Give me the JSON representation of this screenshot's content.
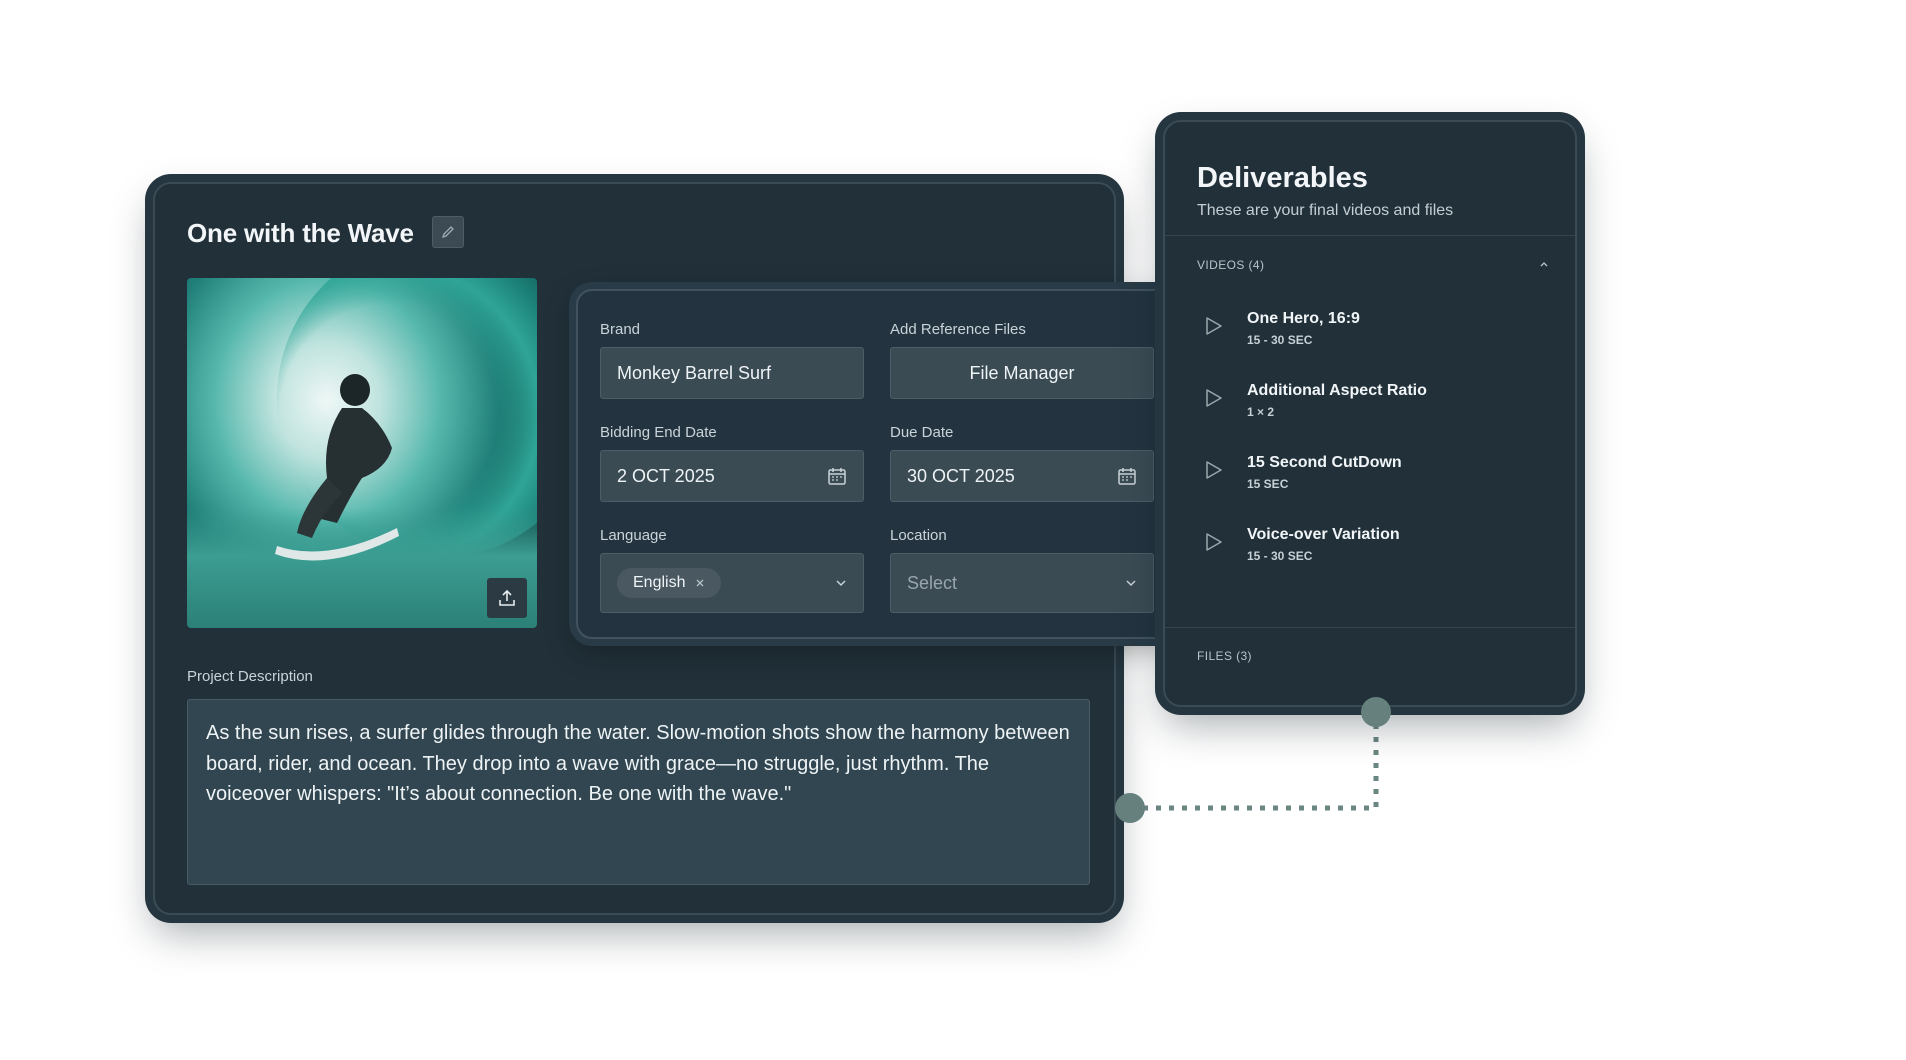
{
  "project": {
    "title": "One with the Wave",
    "description_label": "Project Description",
    "description": "As the sun rises, a surfer glides through the water. Slow-motion shots show the harmony between board, rider, and ocean. They drop into a wave with grace—no struggle, just rhythm. The voiceover whispers: \"It’s about connection. Be one with the wave.\""
  },
  "form": {
    "brand_label": "Brand",
    "brand_value": "Monkey Barrel Surf",
    "ref_label": "Add Reference Files",
    "ref_button": "File Manager",
    "bidding_label": "Bidding End Date",
    "bidding_value": "2 OCT 2025",
    "due_label": "Due Date",
    "due_value": "30 OCT 2025",
    "language_label": "Language",
    "language_value": "English",
    "location_label": "Location",
    "location_placeholder": "Select"
  },
  "deliverables": {
    "title": "Deliverables",
    "subtitle": "These are your final videos and files",
    "videos_label": "VIDEOS (4)",
    "files_label": "FILES (3)",
    "videos": [
      {
        "name": "One Hero, 16:9",
        "duration": "15 - 30 SEC"
      },
      {
        "name": "Additional Aspect Ratio",
        "duration": "1 × 2"
      },
      {
        "name": "15 Second CutDown",
        "duration": "15 SEC"
      },
      {
        "name": "Voice-over Variation",
        "duration": "15 - 30 SEC"
      }
    ]
  },
  "colors": {
    "panel": "#213039",
    "field": "#3b4b54",
    "connector": "#65807d"
  }
}
